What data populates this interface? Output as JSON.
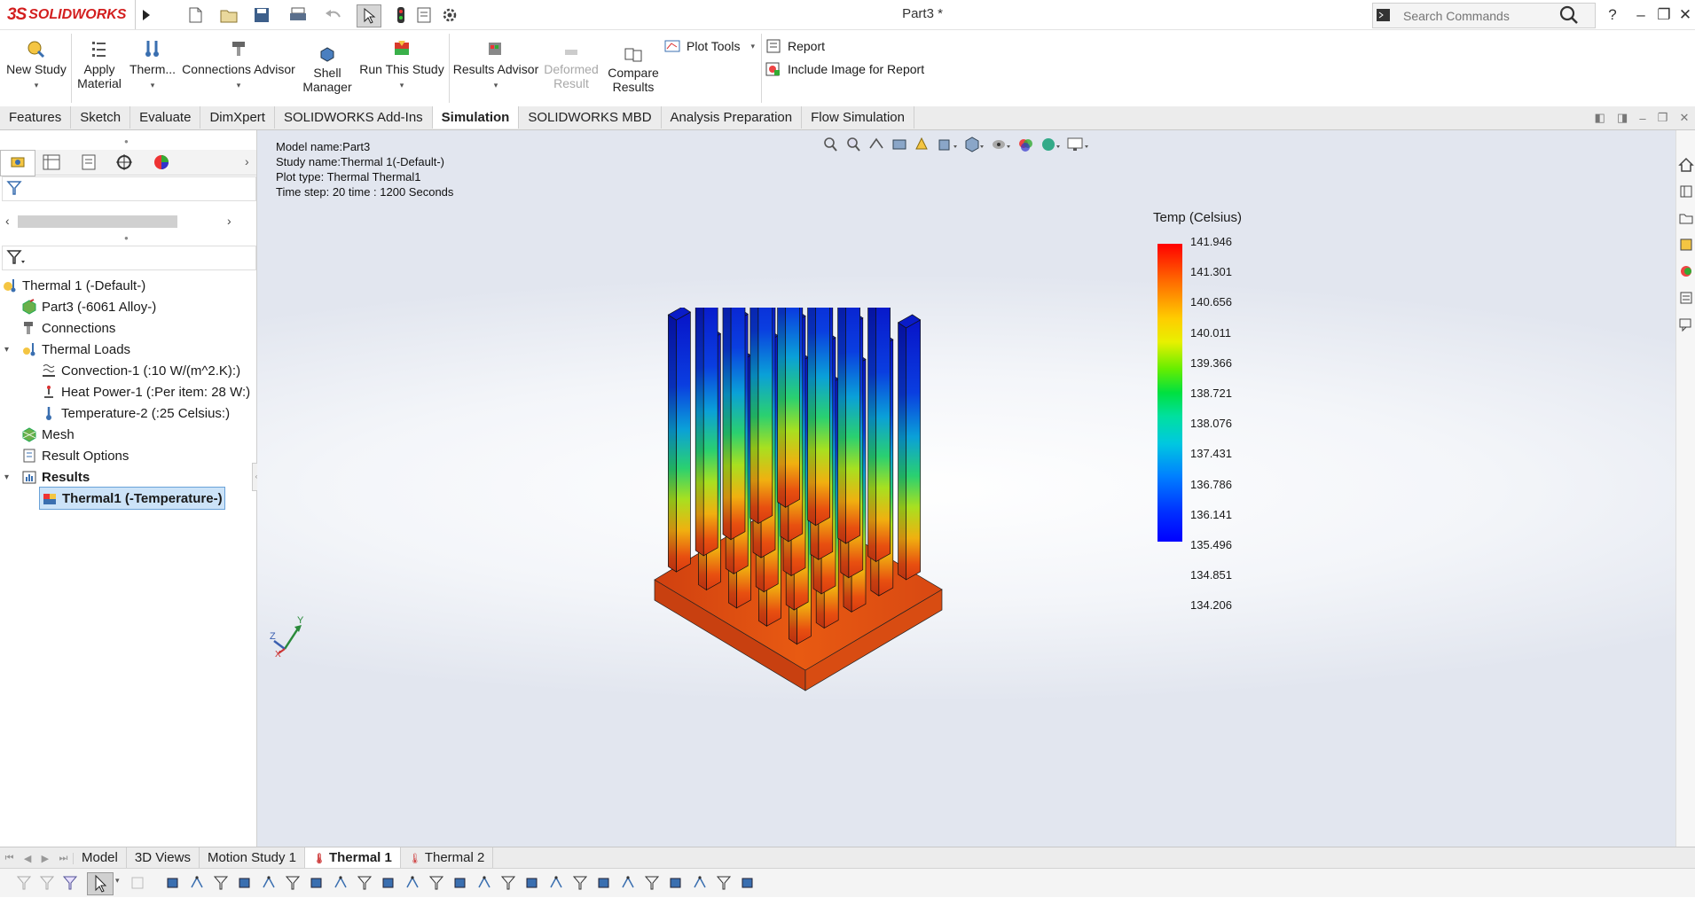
{
  "app": {
    "logo_ds": "3S",
    "logo_text": "SOLIDWORKS",
    "document_title": "Part3 *"
  },
  "search": {
    "placeholder": "Search Commands"
  },
  "window_controls": {
    "help": "?",
    "minimize": "–",
    "restore": "❐",
    "close": "✕"
  },
  "ribbon": {
    "new_study": "New Study",
    "apply_material": "Apply\nMaterial",
    "thermal": "Therm...",
    "connections_advisor": "Connections Advisor",
    "shell_manager": "Shell\nManager",
    "run_this_study": "Run This Study",
    "results_advisor": "Results Advisor",
    "deformed_result": "Deformed\nResult",
    "compare_results": "Compare\nResults",
    "plot_tools": "Plot Tools",
    "report": "Report",
    "include_image": "Include Image for Report"
  },
  "command_tabs": [
    "Features",
    "Sketch",
    "Evaluate",
    "DimXpert",
    "SOLIDWORKS Add-Ins",
    "Simulation",
    "SOLIDWORKS MBD",
    "Analysis Preparation",
    "Flow Simulation"
  ],
  "active_command_tab": "Simulation",
  "tree": {
    "study": "Thermal 1 (-Default-)",
    "part": "Part3 (-6061 Alloy-)",
    "connections": "Connections",
    "thermal_loads": "Thermal Loads",
    "convection": "Convection-1 (:10 W/(m^2.K):)",
    "heat_power": "Heat Power-1 (:Per item: 28 W:)",
    "temperature": "Temperature-2 (:25 Celsius:)",
    "mesh": "Mesh",
    "result_options": "Result Options",
    "results": "Results",
    "thermal1": "Thermal1 (-Temperature-)"
  },
  "plot_info": {
    "model_name": "Model name:Part3",
    "study_name": "Study name:Thermal 1(-Default-)",
    "plot_type": "Plot type: Thermal Thermal1",
    "time_step": "Time step: 20   time : 1200 Seconds"
  },
  "legend": {
    "title": "Temp (Celsius)",
    "values": [
      "141.946",
      "141.301",
      "140.656",
      "140.011",
      "139.366",
      "138.721",
      "138.076",
      "137.431",
      "136.786",
      "136.141",
      "135.496",
      "134.851",
      "134.206"
    ]
  },
  "triad": {
    "y": "Y",
    "z": "Z",
    "x": "X"
  },
  "bottom_tabs": [
    "Model",
    "3D Views",
    "Motion Study 1",
    "Thermal 1",
    "Thermal 2"
  ],
  "active_bottom_tab": "Thermal 1"
}
